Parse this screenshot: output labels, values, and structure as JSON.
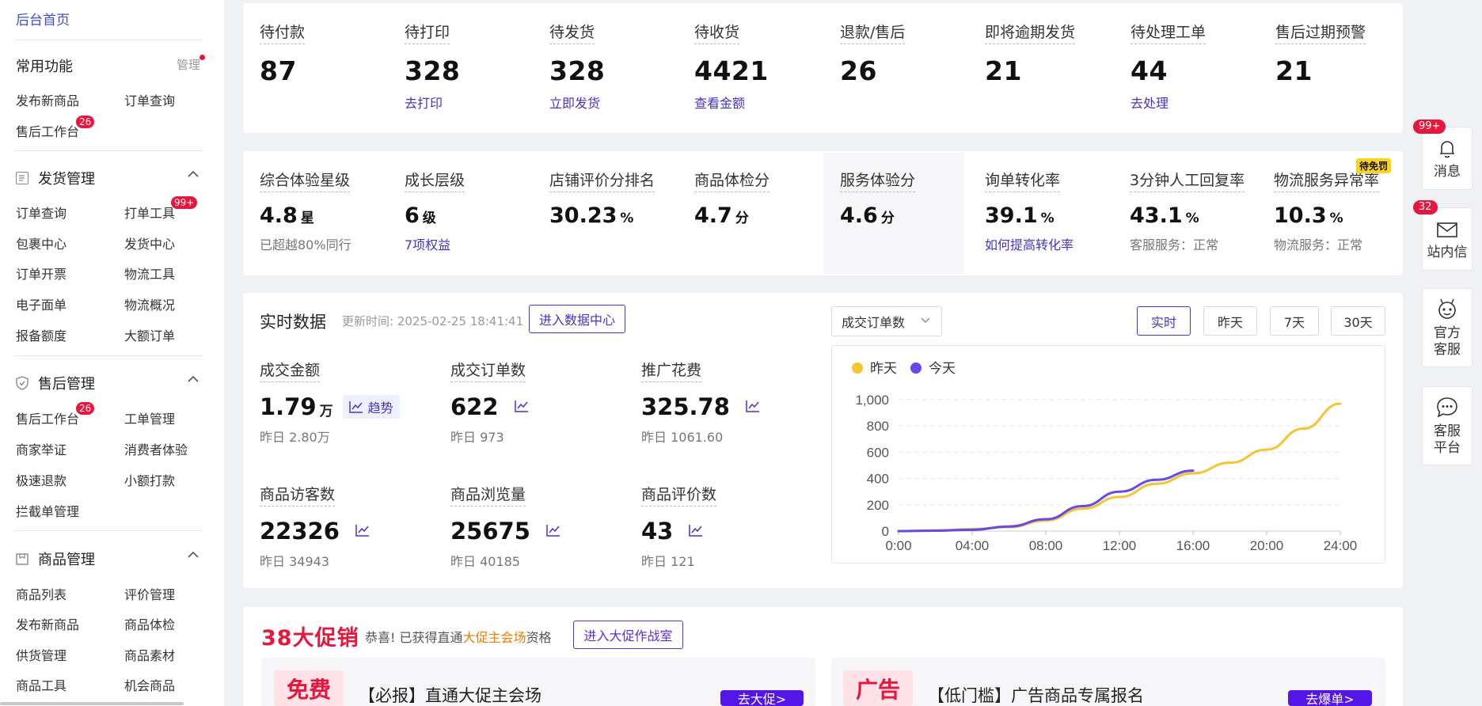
{
  "sidebar": {
    "home": "后台首页",
    "common": {
      "title": "常用功能",
      "manage": "管理",
      "items": [
        "发布新商品",
        "订单查询",
        "售后工作台"
      ],
      "badge": "26"
    },
    "shipping": {
      "title": "发货管理",
      "items": [
        "订单查询",
        "打单工具",
        "包裹中心",
        "发货中心",
        "订单开票",
        "物流工具",
        "电子面单",
        "物流概况",
        "报备额度",
        "大额订单"
      ],
      "badge": "99+"
    },
    "aftersale": {
      "title": "售后管理",
      "items": [
        "售后工作台",
        "工单管理",
        "商家举证",
        "消费者体验",
        "极速退款",
        "小额打款",
        "拦截单管理"
      ],
      "badge": "26"
    },
    "goods": {
      "title": "商品管理",
      "items": [
        "商品列表",
        "评价管理",
        "发布新商品",
        "商品体检",
        "供货管理",
        "商品素材",
        "商品工具",
        "机会商品"
      ]
    }
  },
  "orders": [
    {
      "label": "待付款",
      "value": "87",
      "link": ""
    },
    {
      "label": "待打印",
      "value": "328",
      "link": "去打印"
    },
    {
      "label": "待发货",
      "value": "328",
      "link": "立即发货"
    },
    {
      "label": "待收货",
      "value": "4421",
      "link": "查看金额"
    },
    {
      "label": "退款/售后",
      "value": "26",
      "link": ""
    },
    {
      "label": "即将逾期发货",
      "value": "21",
      "link": ""
    },
    {
      "label": "待处理工单",
      "value": "44",
      "link": "去处理"
    },
    {
      "label": "售后过期预警",
      "value": "21",
      "link": ""
    }
  ],
  "metrics": [
    {
      "label": "综合体验星级",
      "value": "4.8",
      "unit": "星",
      "sub": "已超越80%同行"
    },
    {
      "label": "成长层级",
      "value": "6",
      "unit": "级",
      "sub": "7项权益"
    },
    {
      "label": "店铺评价分排名",
      "value": "30.23",
      "unit": "%",
      "sub": ""
    },
    {
      "label": "商品体检分",
      "value": "4.7",
      "unit": "分",
      "sub": ""
    },
    {
      "label": "服务体验分",
      "value": "4.6",
      "unit": "分",
      "sub": ""
    },
    {
      "label": "询单转化率",
      "value": "39.1",
      "unit": "%",
      "sub": "如何提高转化率"
    },
    {
      "label": "3分钟人工回复率",
      "value": "43.1",
      "unit": "%",
      "sub": "客服服务：正常"
    },
    {
      "label": "物流服务异常率",
      "value": "10.3",
      "unit": "%",
      "sub": "物流服务：正常"
    }
  ],
  "logistics_tag": "待免罚",
  "realtime": {
    "title": "实时数据",
    "updated": "更新时间: 2025-02-25 18:41:41",
    "enter_btn": "进入数据中心",
    "select": "成交订单数",
    "ranges": [
      "实时",
      "昨天",
      "7天",
      "30天"
    ],
    "trend_label": "趋势",
    "items": [
      {
        "label": "成交金额",
        "value": "1.79",
        "unit": "万",
        "prev": "昨日 2.80万"
      },
      {
        "label": "成交订单数",
        "value": "622",
        "unit": "",
        "prev": "昨日 973"
      },
      {
        "label": "推广花费",
        "value": "325.78",
        "unit": "",
        "prev": "昨日 1061.60"
      },
      {
        "label": "商品访客数",
        "value": "22326",
        "unit": "",
        "prev": "昨日 34943"
      },
      {
        "label": "商品浏览量",
        "value": "25675",
        "unit": "",
        "prev": "昨日 40185"
      },
      {
        "label": "商品评价数",
        "value": "43",
        "unit": "",
        "prev": "昨日 121"
      }
    ]
  },
  "chart_data": {
    "type": "line",
    "x": [
      "0:00",
      "02:00",
      "04:00",
      "06:00",
      "08:00",
      "10:00",
      "12:00",
      "14:00",
      "16:00",
      "18:00",
      "20:00",
      "22:00",
      "24:00"
    ],
    "x_ticks": [
      "0:00",
      "04:00",
      "08:00",
      "12:00",
      "16:00",
      "20:00",
      "24:00"
    ],
    "ylim": [
      0,
      1000
    ],
    "y_ticks": [
      "0",
      "200",
      "400",
      "600",
      "800",
      "1,000"
    ],
    "legend": "top-left",
    "grid": true,
    "series": [
      {
        "name": "昨天",
        "color": "#f5c430",
        "values": [
          0,
          5,
          15,
          30,
          80,
          170,
          260,
          360,
          440,
          520,
          620,
          780,
          970
        ]
      },
      {
        "name": "今天",
        "color": "#6748e8",
        "values": [
          0,
          3,
          10,
          35,
          90,
          190,
          300,
          390,
          460
        ]
      }
    ]
  },
  "promo": {
    "title": "38大促销",
    "text_before": "恭喜! 已获得直通",
    "text_highlight": "大促主会场",
    "text_after": "资格",
    "button": "进入大促作战室",
    "cards": [
      {
        "tag": "免费",
        "text": "【必报】直通大促主会场",
        "button": "去大促>"
      },
      {
        "tag": "广告",
        "text": "【低门槛】广告商品专属报名",
        "button": "去爆单>"
      }
    ]
  },
  "float": [
    {
      "label": "消息",
      "badge": "99+",
      "icon": "bell-icon"
    },
    {
      "label": "站内信",
      "badge": "32",
      "icon": "mail-icon"
    },
    {
      "label": "官方客服",
      "badge": "",
      "icon": "robot-icon"
    },
    {
      "label": "客服平台",
      "badge": "",
      "icon": "chat-icon"
    }
  ]
}
